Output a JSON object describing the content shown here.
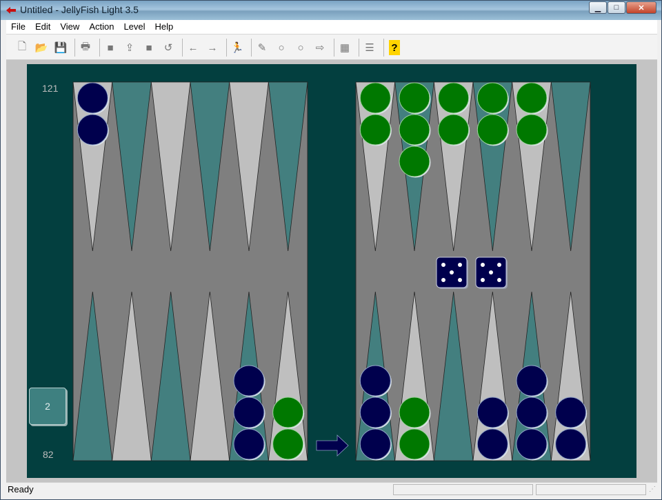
{
  "window": {
    "title": "Untitled - JellyFish Light 3.5"
  },
  "menu": [
    "File",
    "Edit",
    "View",
    "Action",
    "Level",
    "Help"
  ],
  "toolbar": [
    {
      "name": "new-icon",
      "glyph": "🗋"
    },
    {
      "name": "open-icon",
      "glyph": "📂"
    },
    {
      "name": "save-icon",
      "glyph": "💾"
    },
    {
      "sep": true
    },
    {
      "name": "print-icon",
      "glyph": "🖶"
    },
    {
      "sep": true
    },
    {
      "name": "stop-icon",
      "glyph": "■"
    },
    {
      "name": "upload-icon",
      "glyph": "⇪"
    },
    {
      "name": "square-icon",
      "glyph": "■"
    },
    {
      "name": "undo-icon",
      "glyph": "↺"
    },
    {
      "sep": true
    },
    {
      "name": "back-arrow-icon",
      "glyph": "←"
    },
    {
      "name": "forward-arrow-icon",
      "glyph": "→"
    },
    {
      "sep": true
    },
    {
      "name": "runner-icon",
      "glyph": "🏃"
    },
    {
      "sep": true
    },
    {
      "name": "pencil-icon",
      "glyph": "✎"
    },
    {
      "name": "circle-icon-1",
      "glyph": "○"
    },
    {
      "name": "circle-icon-2",
      "glyph": "○"
    },
    {
      "name": "hollow-arrow-icon",
      "glyph": "⇨"
    },
    {
      "sep": true
    },
    {
      "name": "board-icon",
      "glyph": "▦"
    },
    {
      "sep": true
    },
    {
      "name": "list-icon",
      "glyph": "☰"
    },
    {
      "sep": true
    },
    {
      "name": "help-icon",
      "glyph": "?"
    }
  ],
  "colors": {
    "board_bg": "#033f3f",
    "table": "#7f7f7f",
    "point_light": "#bfbfbf",
    "point_teal": "#437f7f",
    "player_blue": "#00004d",
    "player_green": "#007800"
  },
  "game": {
    "pip_top": "121",
    "pip_bottom": "82",
    "cube_value": "2",
    "dice": [
      5,
      5
    ],
    "turn_arrow": "right",
    "top_points": [
      {
        "checkers": 2,
        "color": "blue"
      },
      {
        "checkers": 0
      },
      {
        "checkers": 0
      },
      {
        "checkers": 0
      },
      {
        "checkers": 0
      },
      {
        "checkers": 0
      },
      {
        "checkers": 2,
        "color": "green"
      },
      {
        "checkers": 3,
        "color": "green"
      },
      {
        "checkers": 2,
        "color": "green"
      },
      {
        "checkers": 2,
        "color": "green"
      },
      {
        "checkers": 2,
        "color": "green"
      },
      {
        "checkers": 0
      }
    ],
    "bottom_points": [
      {
        "checkers": 0
      },
      {
        "checkers": 0
      },
      {
        "checkers": 0
      },
      {
        "checkers": 0
      },
      {
        "checkers": 3,
        "color": "blue"
      },
      {
        "checkers": 2,
        "color": "green"
      },
      {
        "checkers": 3,
        "color": "blue"
      },
      {
        "checkers": 2,
        "color": "green"
      },
      {
        "checkers": 0
      },
      {
        "checkers": 2,
        "color": "blue"
      },
      {
        "checkers": 3,
        "color": "blue"
      },
      {
        "checkers": 2,
        "color": "blue"
      }
    ]
  },
  "status": {
    "text": "Ready"
  }
}
